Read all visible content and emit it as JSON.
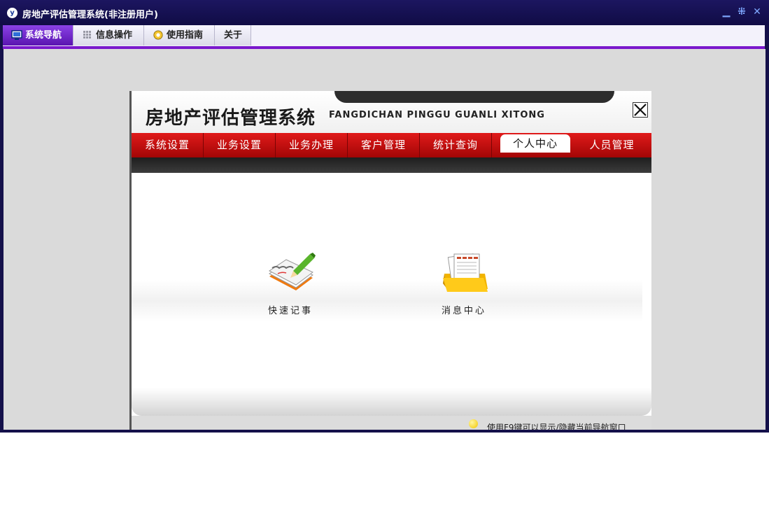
{
  "window": {
    "title": "房地产评估管理系统(非注册用户)",
    "controls": [
      "minimize-icon",
      "restore-icon",
      "close-icon"
    ]
  },
  "menubar": {
    "tabs": [
      {
        "label": "系统导航",
        "icon": "monitor-icon",
        "active": true
      },
      {
        "label": "信息操作",
        "icon": "grid-icon",
        "active": false
      },
      {
        "label": "使用指南",
        "icon": "compass-icon",
        "active": false
      },
      {
        "label": "关于",
        "icon": "",
        "active": false
      }
    ]
  },
  "panel": {
    "title": "房地产评估管理系统",
    "subtitle": "FANGDICHAN PINGGU GUANLI XITONG"
  },
  "nav": {
    "items": [
      "系统设置",
      "业务设置",
      "业务办理",
      "客户管理",
      "统计查询",
      "个人中心",
      "人员管理"
    ],
    "active_index": 5
  },
  "launchers": [
    {
      "label": "快速记事",
      "icon": "notepad-pencil-icon"
    },
    {
      "label": "消息中心",
      "icon": "message-folder-icon"
    }
  ],
  "status": {
    "tip": "使用F9键可以显示/隐藏当前导航窗口"
  },
  "colors": {
    "accent": "#7a18cc",
    "nav_red": "#c80f0f",
    "titlebar": "#14104a"
  }
}
